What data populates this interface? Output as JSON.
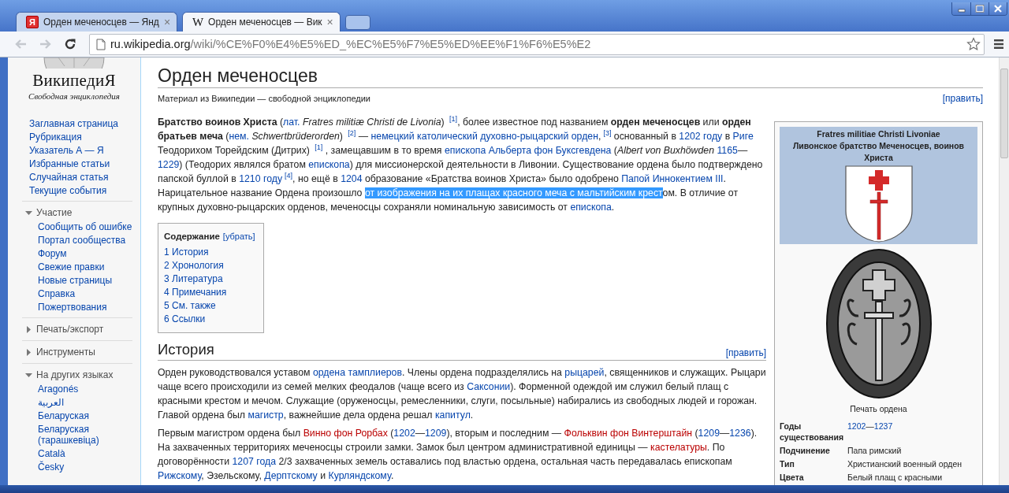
{
  "browser": {
    "tabs": [
      {
        "kind": "letter-badge",
        "favicon": "Я",
        "title": "Орден меченосцев — Янд",
        "close": "×",
        "selected": false
      },
      {
        "kind": "serif-letter",
        "favicon": "W",
        "title": "Орден меченосцев — Вик",
        "close": "×",
        "selected": true
      }
    ],
    "back_disabled": true,
    "forward_disabled": true,
    "address": {
      "host": "ru.wikipedia.org",
      "path": "/wiki/%CE%F0%E4%E5%ED_%EC%E5%F7%E5%ED%EE%F1%F6%E5%E2"
    }
  },
  "sidebar": {
    "logo": {
      "name": "ВикипедиЯ",
      "tagline": "Свободная энциклопедия"
    },
    "navigation": [
      "Заглавная страница",
      "Рубрикация",
      "Указатель А — Я",
      "Избранные статьи",
      "Случайная статья",
      "Текущие события"
    ],
    "sections": [
      {
        "title": "Участие",
        "expanded": true,
        "items": [
          "Сообщить об ошибке",
          "Портал сообщества",
          "Форум",
          "Свежие правки",
          "Новые страницы",
          "Справка",
          "Пожертвования"
        ]
      },
      {
        "title": "Печать/экспорт",
        "expanded": false
      },
      {
        "title": "Инструменты",
        "expanded": false
      },
      {
        "title": "На других языках",
        "expanded": true,
        "items": [
          "Aragonés",
          "العربية",
          "Беларуская",
          "Беларуская (тарашкевіца)",
          "Català",
          "Česky"
        ]
      }
    ]
  },
  "article": {
    "title": "Орден меченосцев",
    "tagline": "Материал из Википедии — свободной энциклопедии",
    "edit": "[править]",
    "intro": [
      {
        "kind": "text",
        "text": "**Братство воинов Христа** ("
      },
      {
        "kind": "link",
        "text": "лат."
      },
      {
        "kind": "text",
        "text": " *Fratres militiæ Christi de Livonia*) "
      },
      {
        "kind": "ref",
        "text": "[1]"
      },
      {
        "kind": "text",
        "text": ", более известное под названием **орден меченосцев** или **орден братьев меча** ("
      },
      {
        "kind": "link",
        "text": "нем."
      },
      {
        "kind": "text",
        "text": " *Schwertbrüderorden*) "
      },
      {
        "kind": "ref",
        "text": "[2]"
      },
      {
        "kind": "text",
        "text": " — "
      },
      {
        "kind": "link",
        "text": "немецкий католический духовно-рыцарский орден"
      },
      {
        "kind": "text",
        "text": ","
      },
      {
        "kind": "ref",
        "text": "[3]"
      },
      {
        "kind": "text",
        "text": " основанный в "
      },
      {
        "kind": "link",
        "text": "1202 году"
      },
      {
        "kind": "text",
        "text": " в "
      },
      {
        "kind": "link",
        "text": "Риге"
      },
      {
        "kind": "text",
        "text": " Теодорихом Торейдским (Дитрих) "
      },
      {
        "kind": "ref",
        "text": "[1]"
      },
      {
        "kind": "text",
        "text": " , замещавшим в то время "
      },
      {
        "kind": "link",
        "text": "епископа Альберта фон Буксгевдена"
      },
      {
        "kind": "text",
        "text": " (*Albert von Buxhöwden* "
      },
      {
        "kind": "link",
        "text": "1165"
      },
      {
        "kind": "text",
        "text": "—"
      },
      {
        "kind": "link",
        "text": "1229"
      },
      {
        "kind": "text",
        "text": ") (Теодорих являлся братом "
      },
      {
        "kind": "link",
        "text": "епископа"
      },
      {
        "kind": "text",
        "text": ") для миссионерской деятельности в Ливонии. Существование ордена было подтверждено папской буллой в "
      },
      {
        "kind": "link",
        "text": "1210 году"
      },
      {
        "kind": "ref",
        "text": "[4]"
      },
      {
        "kind": "text",
        "text": ", но ещё в "
      },
      {
        "kind": "link",
        "text": "1204"
      },
      {
        "kind": "text",
        "text": " образование «Братства воинов Христа» было одобрено "
      },
      {
        "kind": "link",
        "text": "Папой Иннокентием III"
      },
      {
        "kind": "text",
        "text": ". Нарицательное название Ордена произошло "
      },
      {
        "kind": "selected",
        "text": "от изображения на их плащах красного меча с мальтийским крест"
      },
      {
        "kind": "text",
        "text": "ом. В отличие от крупных духовно-рыцарских орденов, меченосцы сохраняли номинальную зависимость от "
      },
      {
        "kind": "link",
        "text": "епископа"
      },
      {
        "kind": "text",
        "text": "."
      }
    ],
    "toc": {
      "title": "Содержание",
      "toggle": "[убрать]",
      "items": [
        "1 История",
        "2 Хронология",
        "3 Литература",
        "4 Примечания",
        "5 См. также",
        "6 Ссылки"
      ]
    },
    "sections": [
      {
        "heading": "История",
        "edit": "[править]",
        "paragraphs": [
          [
            {
              "kind": "text",
              "text": "Орден руководствовался уставом "
            },
            {
              "kind": "link",
              "text": "ордена тамплиеров"
            },
            {
              "kind": "text",
              "text": ". Члены ордена подразделялись на "
            },
            {
              "kind": "link",
              "text": "рыцарей"
            },
            {
              "kind": "text",
              "text": ", священников и служащих. Рыцари чаще всего происходили из семей мелких феодалов (чаще всего из "
            },
            {
              "kind": "link",
              "text": "Саксонии"
            },
            {
              "kind": "text",
              "text": "). Форменной одеждой им служил белый плащ с красными крестом и мечом. Служащие (оруженосцы, ремесленники, слуги, посыльные) набирались из свободных людей и горожан. Главой ордена был "
            },
            {
              "kind": "link",
              "text": "магистр"
            },
            {
              "kind": "text",
              "text": ", важнейшие дела ордена решал "
            },
            {
              "kind": "link",
              "text": "капитул"
            },
            {
              "kind": "text",
              "text": "."
            }
          ],
          [
            {
              "kind": "text",
              "text": "Первым магистром ордена был "
            },
            {
              "kind": "redlink",
              "text": "Винно фон Рорбах"
            },
            {
              "kind": "text",
              "text": " ("
            },
            {
              "kind": "link",
              "text": "1202"
            },
            {
              "kind": "text",
              "text": "—"
            },
            {
              "kind": "link",
              "text": "1209"
            },
            {
              "kind": "text",
              "text": "), вторым и последним — "
            },
            {
              "kind": "redlink",
              "text": "Фольквин фон Винтерштайн"
            },
            {
              "kind": "text",
              "text": " ("
            },
            {
              "kind": "link",
              "text": "1209"
            },
            {
              "kind": "text",
              "text": "—"
            },
            {
              "kind": "link",
              "text": "1236"
            },
            {
              "kind": "text",
              "text": "). На захваченных территориях меченосцы строили замки. Замок был центром административной единицы — "
            },
            {
              "kind": "redlink",
              "text": "кастелатуры"
            },
            {
              "kind": "text",
              "text": ". По договорённости "
            },
            {
              "kind": "link",
              "text": "1207 года"
            },
            {
              "kind": "text",
              "text": " 2/3 захваченных земель оставались под властью ордена, остальная часть передавалась епископам "
            },
            {
              "kind": "link",
              "text": "Рижскому"
            },
            {
              "kind": "text",
              "text": ", Эзельскому, "
            },
            {
              "kind": "link",
              "text": "Дерптскому"
            },
            {
              "kind": "text",
              "text": " и "
            },
            {
              "kind": "link",
              "text": "Курляндскому"
            },
            {
              "kind": "text",
              "text": "."
            }
          ]
        ]
      }
    ],
    "infobox": {
      "header": [
        "Fratres militiae Christi Livoniae",
        "Ливонское братство Меченосцев, воинов Христа"
      ],
      "caption": "Печать ордена",
      "rows": [
        {
          "label": "Годы существования",
          "value": [
            {
              "kind": "link",
              "text": "1202"
            },
            {
              "kind": "text",
              "text": "—"
            },
            {
              "kind": "link",
              "text": "1237"
            }
          ]
        },
        {
          "label": "Подчинение",
          "value": [
            {
              "kind": "text",
              "text": "Папа римский"
            }
          ]
        },
        {
          "label": "Тип",
          "value": [
            {
              "kind": "text",
              "text": "Христианский военный орден"
            }
          ]
        },
        {
          "label": "Цвета",
          "value": [
            {
              "kind": "text",
              "text": "Белый плащ с красными"
            }
          ]
        }
      ]
    }
  }
}
